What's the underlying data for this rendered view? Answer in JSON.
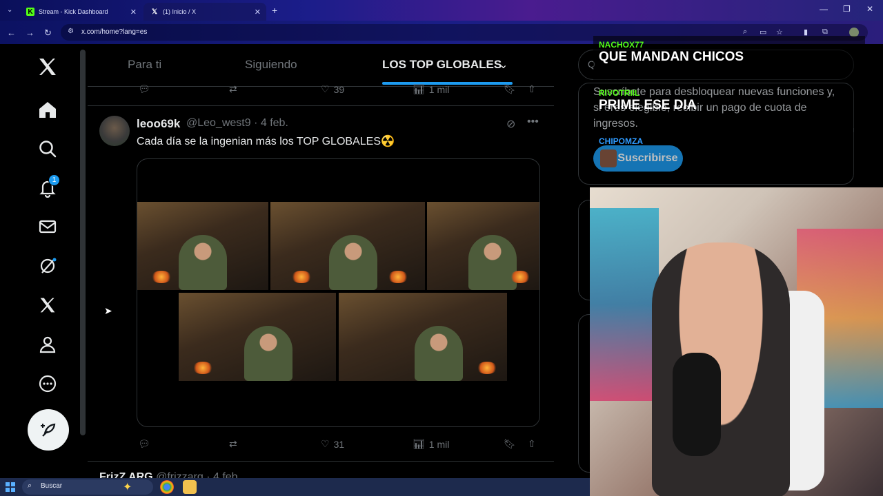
{
  "browser": {
    "tabs": [
      {
        "label": "Stream - Kick Dashboard",
        "icon": "kick-icon",
        "color": "#53fc18"
      },
      {
        "label": "(1) Inicio / X",
        "icon": "x-icon",
        "color": "#ffffff"
      }
    ],
    "url": "x.com/home?lang=es"
  },
  "nav": {
    "icons": [
      "x-logo-icon",
      "home-icon",
      "search-icon",
      "bell-icon",
      "mail-icon",
      "grok-icon",
      "x-premium-icon",
      "profile-icon",
      "more-icon"
    ],
    "notif_count": "1"
  },
  "feed": {
    "tabs": [
      {
        "label": "Para ti",
        "active": false
      },
      {
        "label": "Siguiendo",
        "active": false
      },
      {
        "label": "LOS TOP GLOBALES",
        "active": true
      }
    ],
    "prev_actions": {
      "likes": "39",
      "views": "1 mil"
    },
    "tweet": {
      "name": "leoo69k",
      "handle_date": "@Leo_west9 · 4 feb.",
      "text": "Cada día se la ingenian más los TOP GLOBALES☢️",
      "likes": "31",
      "views": "1 mil"
    },
    "next_tweet": {
      "name": "FrizZ ARG",
      "handle_date": "@frizzarg · 4 feb."
    }
  },
  "right": {
    "monetization_text": "Suscríbete para desbloquear nuevas funciones y, si eres elegible, recibir un pago de cuota de ingresos.",
    "subscribe_label": "Suscribirse"
  },
  "chat": [
    {
      "user": "NACHOX77",
      "user_color": "#53fc18",
      "text": "QUE MANDAN CHICOS"
    },
    {
      "user": "RIVOTRIIL",
      "user_color": "#53fc18",
      "text": "PRIME ESE DIA"
    },
    {
      "user": "CHIPOMZA",
      "user_color": "#2f9bff",
      "text": ""
    }
  ],
  "taskbar": {
    "search_label": "Buscar"
  }
}
